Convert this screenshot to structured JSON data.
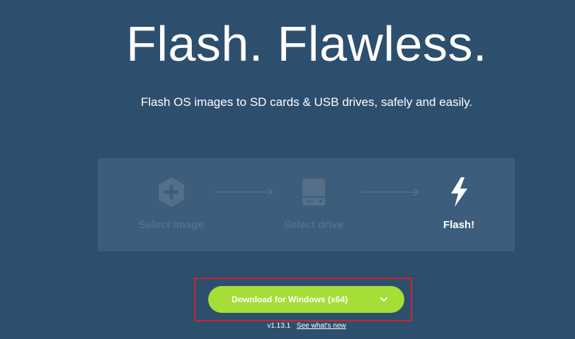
{
  "hero": {
    "title": "Flash. Flawless.",
    "subtitle": "Flash OS images to SD cards & USB drives, safely and easily."
  },
  "steps": [
    {
      "label": "Select image",
      "icon": "plus-hexagon-icon",
      "state": "inactive"
    },
    {
      "label": "Select drive",
      "icon": "drive-icon",
      "state": "inactive"
    },
    {
      "label": "Flash!",
      "icon": "lightning-icon",
      "state": "active"
    }
  ],
  "download": {
    "label": "Download for Windows (x64)",
    "dropdown_icon": "chevron-down-icon"
  },
  "release": {
    "version": "v1.13.1",
    "whats_new": "See what's new"
  },
  "colors": {
    "background": "#2d4f6e",
    "card": "#3c5d7b",
    "dim_text": "#566f88",
    "button": "#a5de37",
    "highlight_border": "#d61f2c"
  }
}
